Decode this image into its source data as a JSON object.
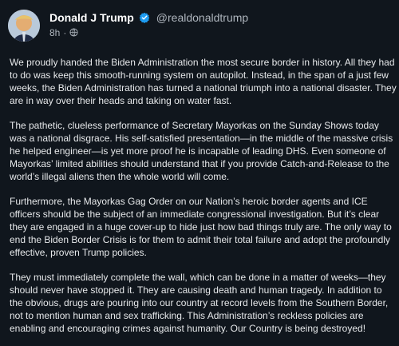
{
  "post": {
    "author": {
      "display_name": "Donald J Trump",
      "handle": "@realdonaldtrump",
      "verified": true
    },
    "timestamp": "8h",
    "visibility_icon": "globe-icon",
    "paragraphs": [
      "We proudly handed the Biden Administration the most secure border in history. All they had to do was keep this smooth-running system on autopilot. Instead, in the span of a just few weeks, the Biden Administration has turned a national triumph into a national disaster. They are in way over their heads and taking on water fast.",
      "The pathetic, clueless performance of Secretary Mayorkas on the Sunday Shows today was a national disgrace. His self-satisfied presentation—in the middle of the massive crisis he helped engineer—is yet more proof he is incapable of leading DHS. Even someone of Mayorkas’ limited abilities should understand that if you provide Catch-and-Release to the world’s illegal aliens then the whole world will come.",
      "Furthermore, the Mayorkas Gag Order on our Nation’s heroic border agents and ICE officers should be the subject of an immediate congressional investigation. But it’s clear they are engaged in a huge cover-up to hide just how bad things truly are. The only way to end the Biden Border Crisis is for them to admit their total failure and adopt the profoundly effective, proven Trump policies.",
      "They must immediately complete the wall, which can be done in a matter of weeks—they should never have stopped it. They are causing death and human tragedy. In addition to the obvious, drugs are pouring into our country at record levels from the Southern Border, not to mention human and sex trafficking. This Administration’s reckless policies are enabling and encouraging crimes against humanity. Our Country is being destroyed!"
    ]
  },
  "colors": {
    "background": "#10161d",
    "text": "#e6e8ea",
    "muted": "#aeb5bd",
    "verified": "#1d9bf0"
  }
}
